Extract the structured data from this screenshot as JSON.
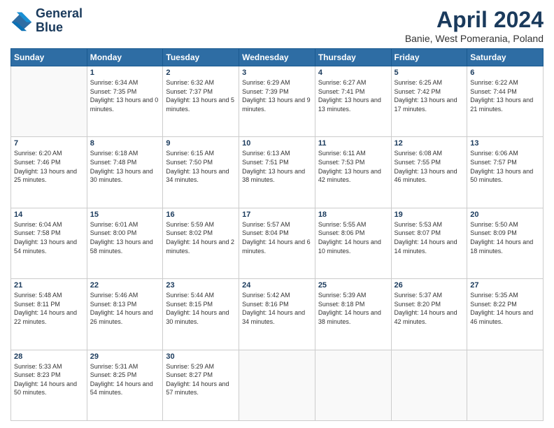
{
  "logo": {
    "line1": "General",
    "line2": "Blue"
  },
  "title": "April 2024",
  "subtitle": "Banie, West Pomerania, Poland",
  "header": {
    "days": [
      "Sunday",
      "Monday",
      "Tuesday",
      "Wednesday",
      "Thursday",
      "Friday",
      "Saturday"
    ]
  },
  "weeks": [
    [
      {
        "day": "",
        "sunrise": "",
        "sunset": "",
        "daylight": ""
      },
      {
        "day": "1",
        "sunrise": "Sunrise: 6:34 AM",
        "sunset": "Sunset: 7:35 PM",
        "daylight": "Daylight: 13 hours and 0 minutes."
      },
      {
        "day": "2",
        "sunrise": "Sunrise: 6:32 AM",
        "sunset": "Sunset: 7:37 PM",
        "daylight": "Daylight: 13 hours and 5 minutes."
      },
      {
        "day": "3",
        "sunrise": "Sunrise: 6:29 AM",
        "sunset": "Sunset: 7:39 PM",
        "daylight": "Daylight: 13 hours and 9 minutes."
      },
      {
        "day": "4",
        "sunrise": "Sunrise: 6:27 AM",
        "sunset": "Sunset: 7:41 PM",
        "daylight": "Daylight: 13 hours and 13 minutes."
      },
      {
        "day": "5",
        "sunrise": "Sunrise: 6:25 AM",
        "sunset": "Sunset: 7:42 PM",
        "daylight": "Daylight: 13 hours and 17 minutes."
      },
      {
        "day": "6",
        "sunrise": "Sunrise: 6:22 AM",
        "sunset": "Sunset: 7:44 PM",
        "daylight": "Daylight: 13 hours and 21 minutes."
      }
    ],
    [
      {
        "day": "7",
        "sunrise": "Sunrise: 6:20 AM",
        "sunset": "Sunset: 7:46 PM",
        "daylight": "Daylight: 13 hours and 25 minutes."
      },
      {
        "day": "8",
        "sunrise": "Sunrise: 6:18 AM",
        "sunset": "Sunset: 7:48 PM",
        "daylight": "Daylight: 13 hours and 30 minutes."
      },
      {
        "day": "9",
        "sunrise": "Sunrise: 6:15 AM",
        "sunset": "Sunset: 7:50 PM",
        "daylight": "Daylight: 13 hours and 34 minutes."
      },
      {
        "day": "10",
        "sunrise": "Sunrise: 6:13 AM",
        "sunset": "Sunset: 7:51 PM",
        "daylight": "Daylight: 13 hours and 38 minutes."
      },
      {
        "day": "11",
        "sunrise": "Sunrise: 6:11 AM",
        "sunset": "Sunset: 7:53 PM",
        "daylight": "Daylight: 13 hours and 42 minutes."
      },
      {
        "day": "12",
        "sunrise": "Sunrise: 6:08 AM",
        "sunset": "Sunset: 7:55 PM",
        "daylight": "Daylight: 13 hours and 46 minutes."
      },
      {
        "day": "13",
        "sunrise": "Sunrise: 6:06 AM",
        "sunset": "Sunset: 7:57 PM",
        "daylight": "Daylight: 13 hours and 50 minutes."
      }
    ],
    [
      {
        "day": "14",
        "sunrise": "Sunrise: 6:04 AM",
        "sunset": "Sunset: 7:58 PM",
        "daylight": "Daylight: 13 hours and 54 minutes."
      },
      {
        "day": "15",
        "sunrise": "Sunrise: 6:01 AM",
        "sunset": "Sunset: 8:00 PM",
        "daylight": "Daylight: 13 hours and 58 minutes."
      },
      {
        "day": "16",
        "sunrise": "Sunrise: 5:59 AM",
        "sunset": "Sunset: 8:02 PM",
        "daylight": "Daylight: 14 hours and 2 minutes."
      },
      {
        "day": "17",
        "sunrise": "Sunrise: 5:57 AM",
        "sunset": "Sunset: 8:04 PM",
        "daylight": "Daylight: 14 hours and 6 minutes."
      },
      {
        "day": "18",
        "sunrise": "Sunrise: 5:55 AM",
        "sunset": "Sunset: 8:06 PM",
        "daylight": "Daylight: 14 hours and 10 minutes."
      },
      {
        "day": "19",
        "sunrise": "Sunrise: 5:53 AM",
        "sunset": "Sunset: 8:07 PM",
        "daylight": "Daylight: 14 hours and 14 minutes."
      },
      {
        "day": "20",
        "sunrise": "Sunrise: 5:50 AM",
        "sunset": "Sunset: 8:09 PM",
        "daylight": "Daylight: 14 hours and 18 minutes."
      }
    ],
    [
      {
        "day": "21",
        "sunrise": "Sunrise: 5:48 AM",
        "sunset": "Sunset: 8:11 PM",
        "daylight": "Daylight: 14 hours and 22 minutes."
      },
      {
        "day": "22",
        "sunrise": "Sunrise: 5:46 AM",
        "sunset": "Sunset: 8:13 PM",
        "daylight": "Daylight: 14 hours and 26 minutes."
      },
      {
        "day": "23",
        "sunrise": "Sunrise: 5:44 AM",
        "sunset": "Sunset: 8:15 PM",
        "daylight": "Daylight: 14 hours and 30 minutes."
      },
      {
        "day": "24",
        "sunrise": "Sunrise: 5:42 AM",
        "sunset": "Sunset: 8:16 PM",
        "daylight": "Daylight: 14 hours and 34 minutes."
      },
      {
        "day": "25",
        "sunrise": "Sunrise: 5:39 AM",
        "sunset": "Sunset: 8:18 PM",
        "daylight": "Daylight: 14 hours and 38 minutes."
      },
      {
        "day": "26",
        "sunrise": "Sunrise: 5:37 AM",
        "sunset": "Sunset: 8:20 PM",
        "daylight": "Daylight: 14 hours and 42 minutes."
      },
      {
        "day": "27",
        "sunrise": "Sunrise: 5:35 AM",
        "sunset": "Sunset: 8:22 PM",
        "daylight": "Daylight: 14 hours and 46 minutes."
      }
    ],
    [
      {
        "day": "28",
        "sunrise": "Sunrise: 5:33 AM",
        "sunset": "Sunset: 8:23 PM",
        "daylight": "Daylight: 14 hours and 50 minutes."
      },
      {
        "day": "29",
        "sunrise": "Sunrise: 5:31 AM",
        "sunset": "Sunset: 8:25 PM",
        "daylight": "Daylight: 14 hours and 54 minutes."
      },
      {
        "day": "30",
        "sunrise": "Sunrise: 5:29 AM",
        "sunset": "Sunset: 8:27 PM",
        "daylight": "Daylight: 14 hours and 57 minutes."
      },
      {
        "day": "",
        "sunrise": "",
        "sunset": "",
        "daylight": ""
      },
      {
        "day": "",
        "sunrise": "",
        "sunset": "",
        "daylight": ""
      },
      {
        "day": "",
        "sunrise": "",
        "sunset": "",
        "daylight": ""
      },
      {
        "day": "",
        "sunrise": "",
        "sunset": "",
        "daylight": ""
      }
    ]
  ]
}
